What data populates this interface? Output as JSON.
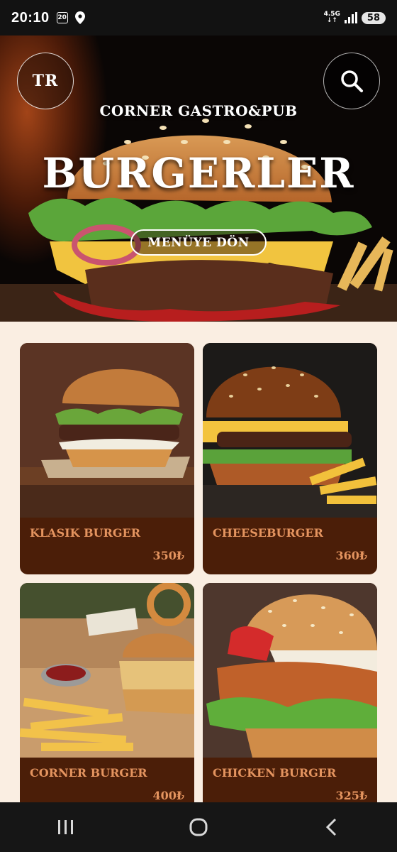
{
  "status_bar": {
    "time": "20:10",
    "notification_badge": "20",
    "network": "4.5G",
    "battery": "58"
  },
  "header": {
    "language_label": "TR",
    "restaurant_name": "CORNER GASTRO&PUB",
    "title": "BURGERLER",
    "back_button_label": "MENÜYE DÖN"
  },
  "products": [
    {
      "name": "KLASIK BURGER",
      "price": "350₺"
    },
    {
      "name": "CHEESEBURGER",
      "price": "360₺"
    },
    {
      "name": "CORNER BURGER",
      "price": "400₺"
    },
    {
      "name": "CHICKEN BURGER",
      "price": "325₺"
    }
  ],
  "colors": {
    "page_background": "#faeee2",
    "card_background": "#4b1e08",
    "card_text": "#e4945f"
  },
  "icons": [
    "location-icon",
    "signal-icon",
    "search-icon",
    "recent-apps-icon",
    "home-icon",
    "back-icon"
  ]
}
